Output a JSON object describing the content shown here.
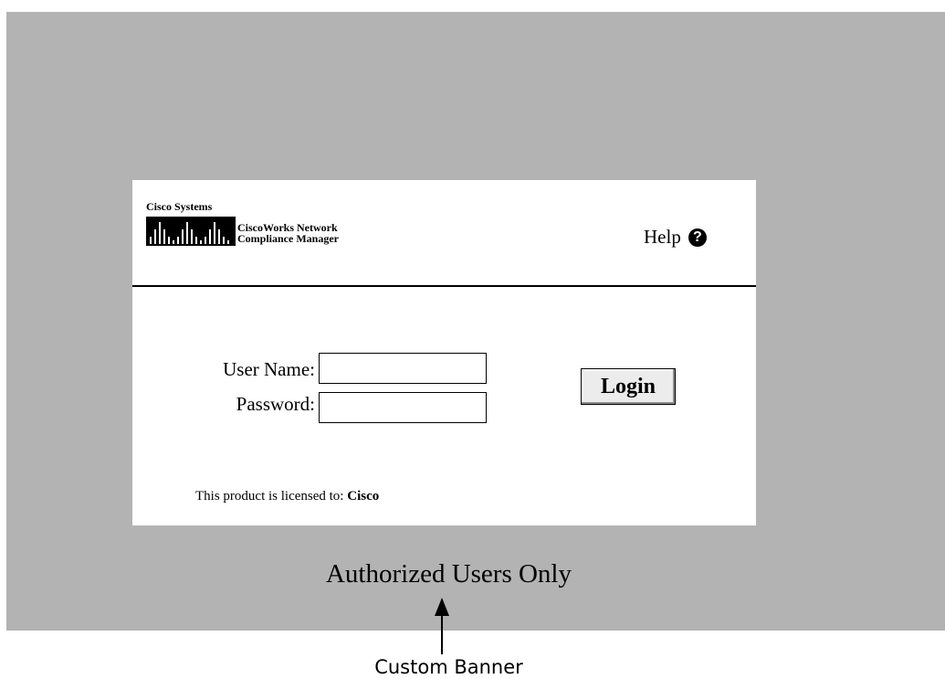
{
  "brand": {
    "company": "Cisco Systems",
    "product_line1": "CiscoWorks Network",
    "product_line2": "Compliance Manager"
  },
  "header": {
    "help_label": "Help",
    "help_icon": "?"
  },
  "form": {
    "username_label": "User Name:",
    "username_value": "",
    "password_label": "Password:",
    "password_value": "",
    "login_label": "Login"
  },
  "license": {
    "prefix": "This product is licensed to:",
    "licensee": "Cisco"
  },
  "banner": {
    "text": "Authorized Users Only"
  },
  "callout": {
    "label": "Custom Banner"
  },
  "colors": {
    "backdrop": "#b3b3b3",
    "panel": "#ffffff"
  }
}
